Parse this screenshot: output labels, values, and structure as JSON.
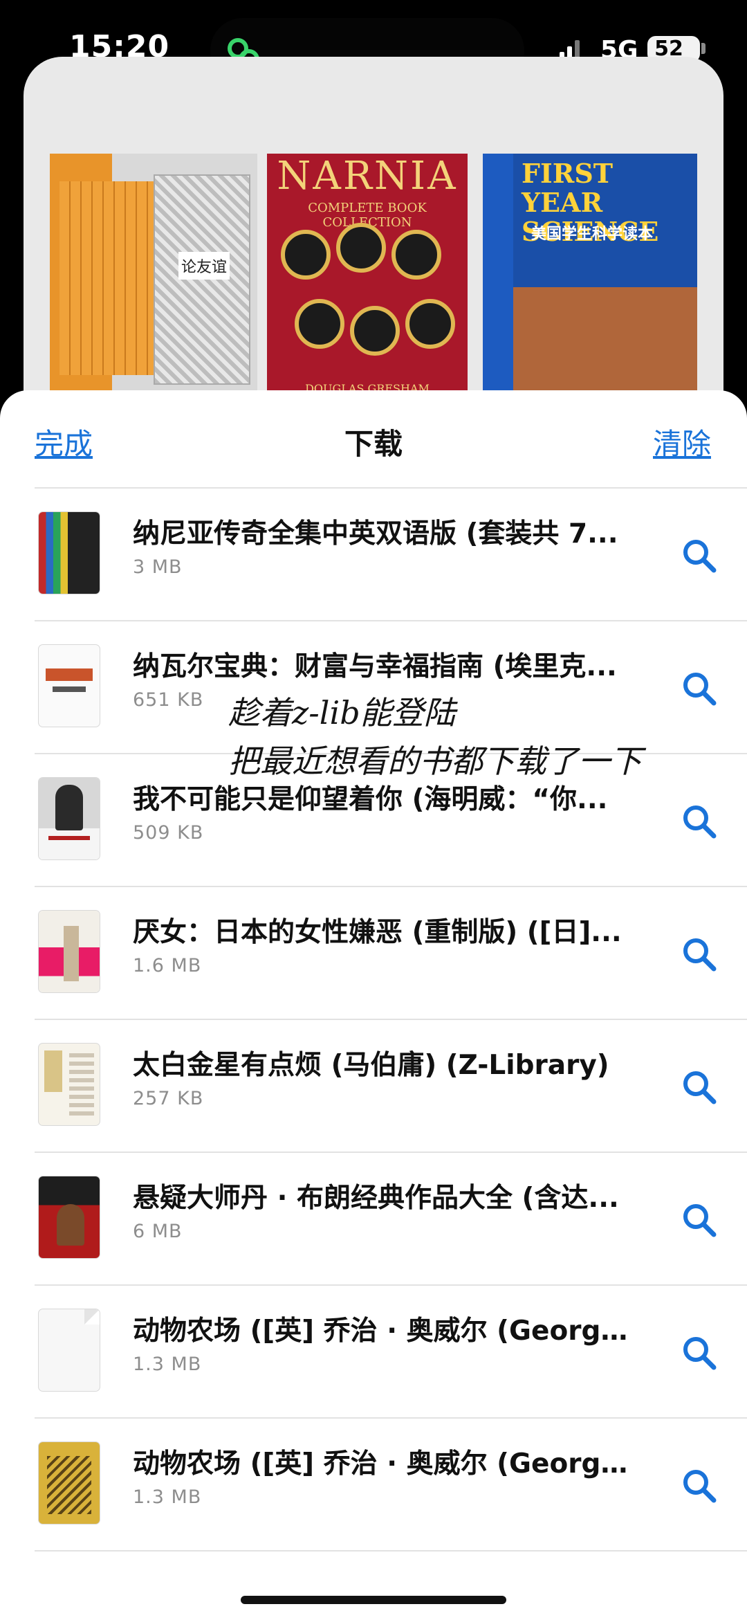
{
  "status_bar": {
    "time": "15:20",
    "network": "5G",
    "battery": "52"
  },
  "background_books": {
    "book1_label": "论友谊",
    "book2_title": "NARNIA",
    "book2_subtitle": "COMPLETE BOOK COLLECTION",
    "book2_author": "DOUGLAS GRESHAM",
    "book3_title": "FIRST YEAR SCIENCE",
    "book3_subtitle": "美国学生科学读本"
  },
  "sheet": {
    "done_label": "完成",
    "title": "下载",
    "clear_label": "清除"
  },
  "downloads": [
    {
      "title": "纳尼亚传奇全集中英双语版 (套装共 7...",
      "size": "3 MB"
    },
    {
      "title": "纳瓦尔宝典：财富与幸福指南 (埃里克...",
      "size": "651 KB"
    },
    {
      "title": "我不可能只是仰望着你 (海明威：“你...",
      "size": "509 KB"
    },
    {
      "title": "厌女：日本的女性嫌恶 (重制版) ([日]...",
      "size": "1.6 MB"
    },
    {
      "title": "太白金星有点烦 (马伯庸) (Z-Library)",
      "size": "257 KB"
    },
    {
      "title": "悬疑大师丹 · 布朗经典作品大全 (含达...",
      "size": "6 MB"
    },
    {
      "title": "动物农场 ([英] 乔治 · 奥威尔 (George...",
      "size": "1.3 MB"
    },
    {
      "title": "动物农场 ([英] 乔治 · 奥威尔 (George...",
      "size": "1.3 MB"
    }
  ],
  "annotation": {
    "line1": "趁着z-lib能登陆",
    "line2": "把最近想看的书都下载了一下"
  },
  "colors": {
    "accent": "#1a73d9"
  }
}
